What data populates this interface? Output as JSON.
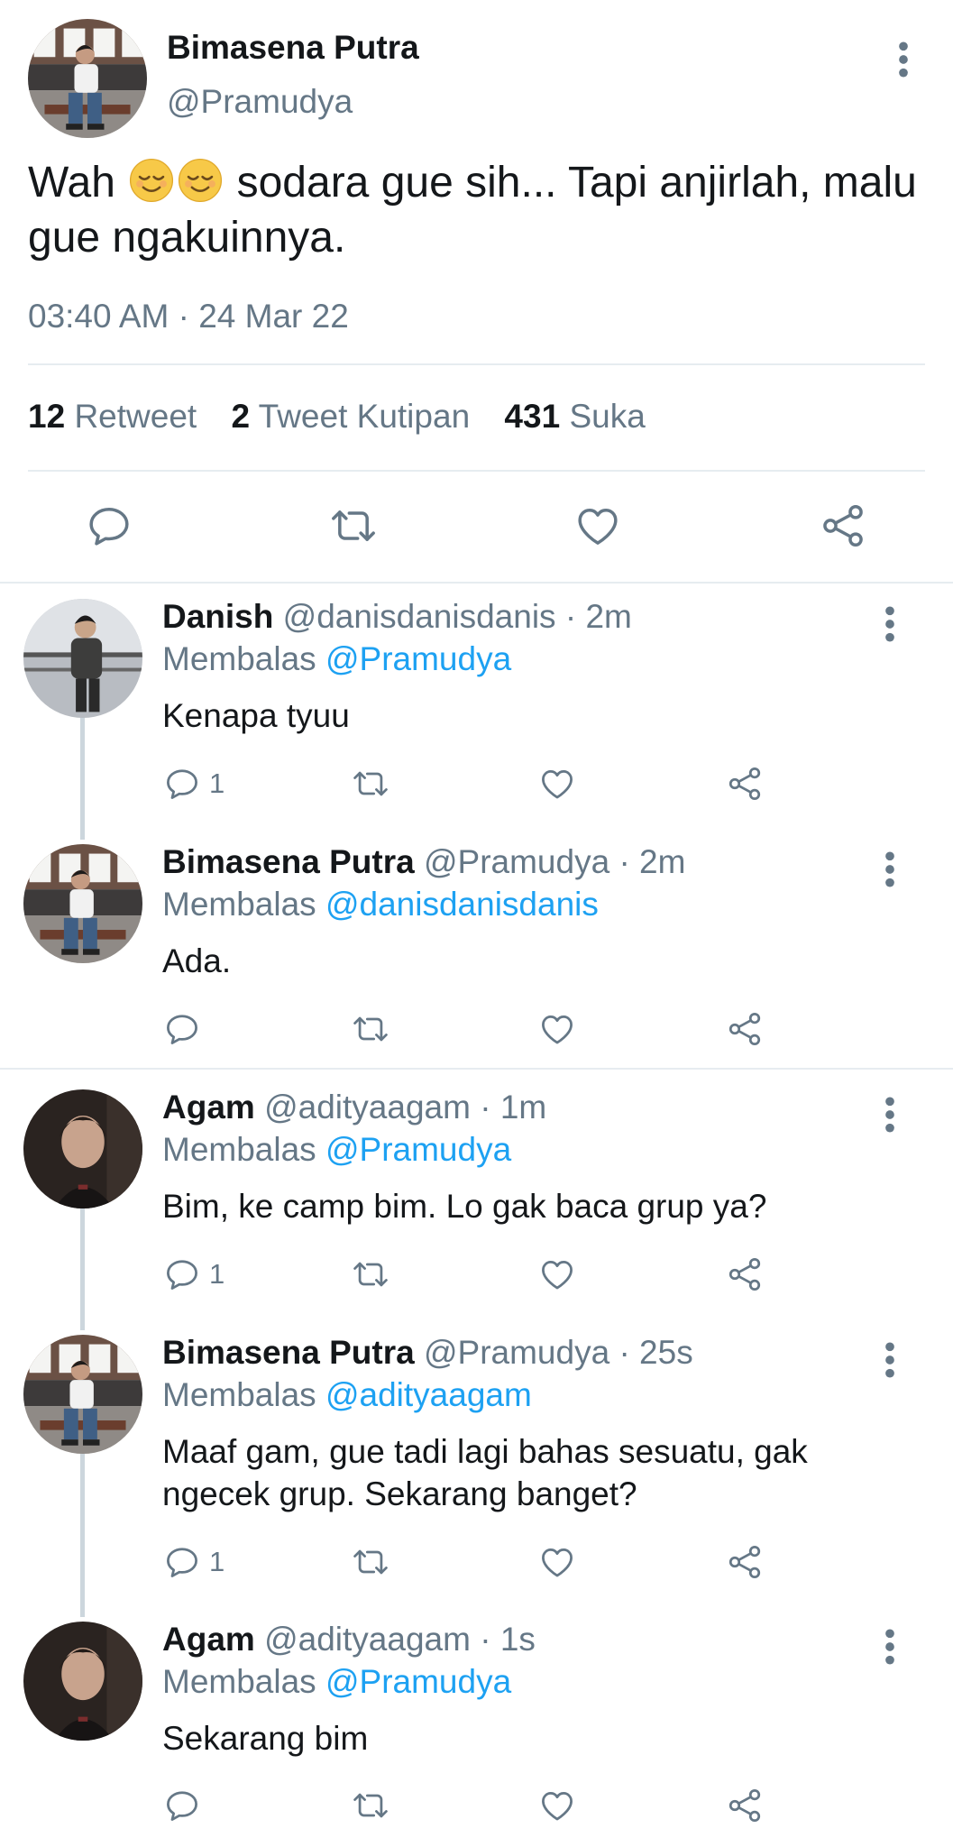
{
  "main_tweet": {
    "name": "Bimasena Putra",
    "handle": "@Pramudya",
    "text_part1": "Wah",
    "emojis": [
      "relieved-face-emoji",
      "relieved-face-emoji"
    ],
    "text_part2": "sodara gue sih... Tapi anjirlah, malu gue ngakuinnya.",
    "timestamp": "03:40 AM · 24 Mar 22",
    "stats": {
      "retweet_count": "12",
      "retweet_label": "Retweet",
      "quote_count": "2",
      "quote_label": "Tweet Kutipan",
      "like_count": "431",
      "like_label": "Suka"
    },
    "actions": [
      "reply-icon",
      "retweet-icon",
      "like-icon",
      "share-icon"
    ]
  },
  "replies": [
    {
      "name": "Danish",
      "handle": "@danisdanisdanis",
      "time": "· 2m",
      "replying_prefix": "Membalas",
      "replying_to": "@Pramudya",
      "text": "Kenapa tyuu",
      "reply_count": "1"
    },
    {
      "name": "Bimasena Putra",
      "handle": "@Pramudya",
      "time": "· 2m",
      "replying_prefix": "Membalas",
      "replying_to": "@danisdanisdanis",
      "text": "Ada.",
      "reply_count": ""
    },
    {
      "name": "Agam",
      "handle": "@adityaagam",
      "time": "· 1m",
      "replying_prefix": "Membalas",
      "replying_to": "@Pramudya",
      "text": "Bim, ke camp bim. Lo gak baca grup ya?",
      "reply_count": "1"
    },
    {
      "name": "Bimasena Putra",
      "handle": "@Pramudya",
      "time": "· 25s",
      "replying_prefix": "Membalas",
      "replying_to": "@adityaagam",
      "text": "Maaf gam, gue tadi lagi bahas sesuatu, gak ngecek grup. Sekarang banget?",
      "reply_count": "1"
    },
    {
      "name": "Agam",
      "handle": "@adityaagam",
      "time": "· 1s",
      "replying_prefix": "Membalas",
      "replying_to": "@Pramudya",
      "text": "Sekarang bim",
      "reply_count": ""
    }
  ],
  "colors": {
    "link": "#1da1f2",
    "secondary_text": "#657786",
    "primary_text": "#14171a",
    "divider": "#e6ecf0"
  }
}
